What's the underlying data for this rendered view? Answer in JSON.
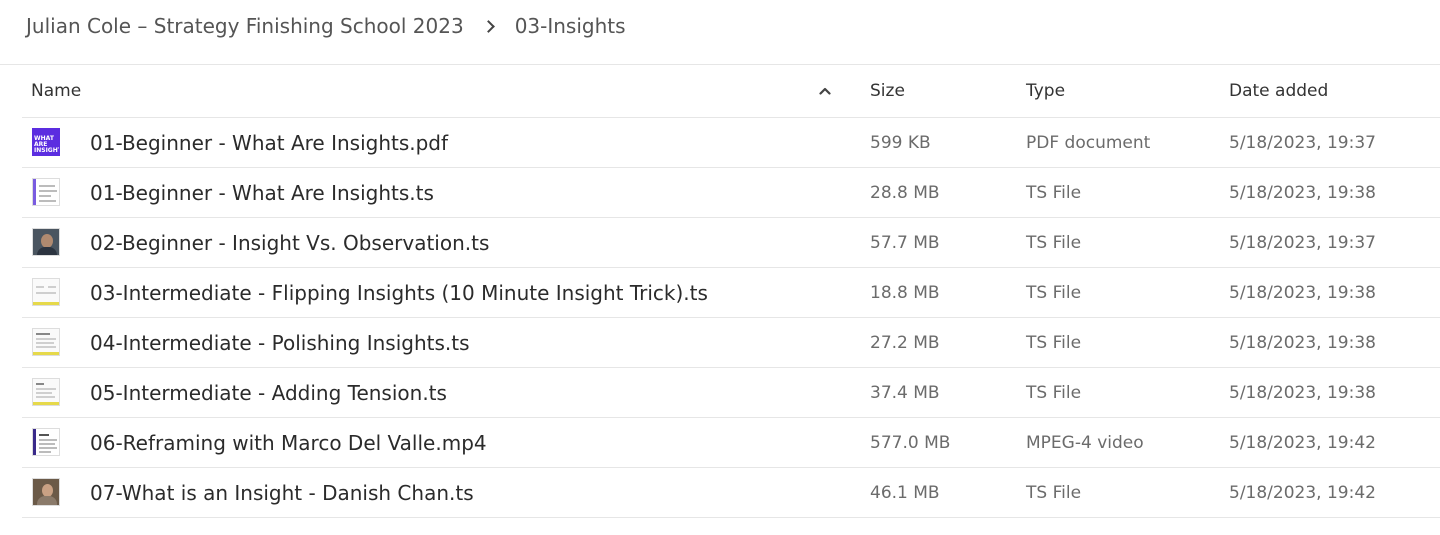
{
  "breadcrumb": {
    "parent": "Julian Cole – Strategy Finishing School 2023",
    "current": "03-Insights"
  },
  "columns": {
    "name": "Name",
    "size": "Size",
    "type": "Type",
    "date": "Date added"
  },
  "sort": {
    "column": "name",
    "direction": "ascending",
    "icon": "chevron-up-icon"
  },
  "files": [
    {
      "name": "01-Beginner - What Are Insights.pdf",
      "size": "599 KB",
      "type": "PDF document",
      "date": "5/18/2023, 19:37",
      "thumb": "WHAT ARE INSIGHTS?"
    },
    {
      "name": "01-Beginner - What Are Insights.ts",
      "size": "28.8 MB",
      "type": "TS File",
      "date": "5/18/2023, 19:38"
    },
    {
      "name": "02-Beginner - Insight Vs. Observation.ts",
      "size": "57.7 MB",
      "type": "TS File",
      "date": "5/18/2023, 19:37"
    },
    {
      "name": "03-Intermediate - Flipping Insights (10 Minute Insight Trick).ts",
      "size": "18.8 MB",
      "type": "TS File",
      "date": "5/18/2023, 19:38"
    },
    {
      "name": "04-Intermediate - Polishing Insights.ts",
      "size": "27.2 MB",
      "type": "TS File",
      "date": "5/18/2023, 19:38"
    },
    {
      "name": "05-Intermediate - Adding Tension.ts",
      "size": "37.4 MB",
      "type": "TS File",
      "date": "5/18/2023, 19:38"
    },
    {
      "name": "06-Reframing with Marco Del Valle.mp4",
      "size": "577.0 MB",
      "type": "MPEG-4 video",
      "date": "5/18/2023, 19:42"
    },
    {
      "name": "07-What is an Insight - Danish Chan.ts",
      "size": "46.1 MB",
      "type": "TS File",
      "date": "5/18/2023, 19:42"
    }
  ]
}
